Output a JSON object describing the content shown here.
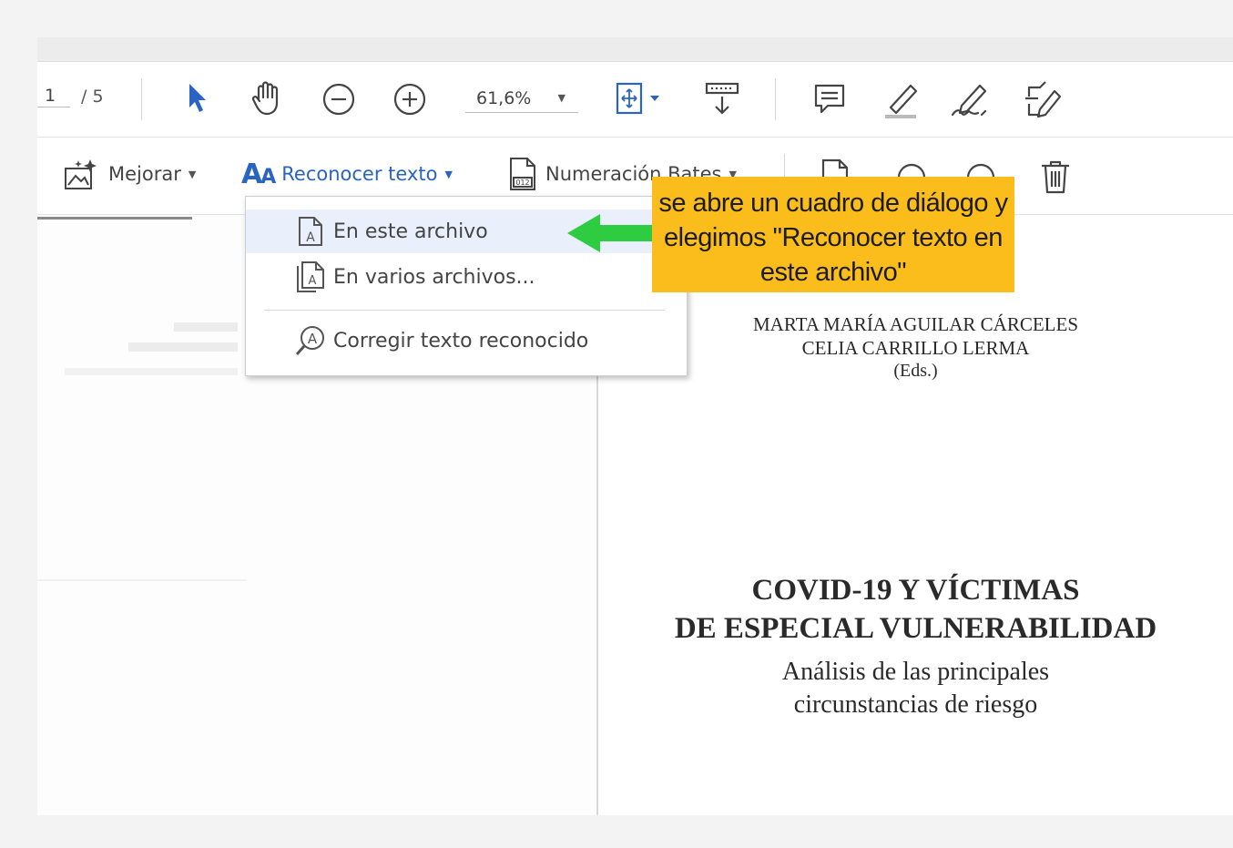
{
  "toolbar": {
    "page_current": "1",
    "page_total": "/ 5",
    "zoom_value": "61,6%"
  },
  "toolbar2": {
    "enhance_label": "Mejorar",
    "recognize_label": "Reconocer texto",
    "bates_label": "Numeración Bates"
  },
  "dropdown": {
    "items": [
      {
        "label": "En este archivo"
      },
      {
        "label": "En varios archivos..."
      },
      {
        "label": "Corregir texto reconocido"
      }
    ]
  },
  "callout": {
    "line1": "se abre un cuadro de diálogo y",
    "line2": "elegimos \"Reconocer texto en",
    "line3": "este archivo\""
  },
  "document": {
    "editors_line1": "MARTA MARÍA AGUILAR CÁRCELES",
    "editors_line2": "CELIA CARRILLO LERMA",
    "editors_line3": "(Eds.)",
    "title_line1": "COVID-19 Y VÍCTIMAS",
    "title_line2": "DE ESPECIAL VULNERABILIDAD",
    "subtitle_line1": "Análisis de las principales",
    "subtitle_line2": "circunstancias de riesgo"
  },
  "colors": {
    "accent_blue": "#2a64c2",
    "callout_bg": "#fbbd1c",
    "arrow_green": "#2ecc40"
  }
}
